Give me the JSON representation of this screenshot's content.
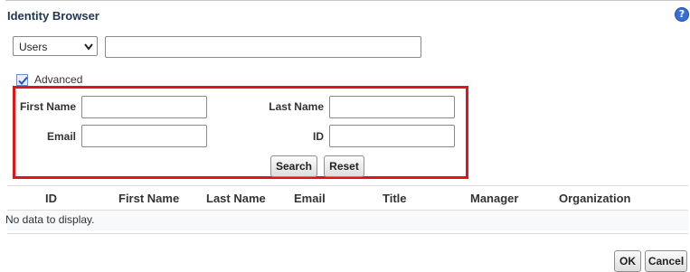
{
  "dialog": {
    "title": "Identity Browser",
    "help_icon": "question-icon"
  },
  "search": {
    "type_selected": "Users",
    "query_value": ""
  },
  "advanced": {
    "label": "Advanced",
    "checked": true
  },
  "fields": {
    "first_name_label": "First Name",
    "last_name_label": "Last Name",
    "email_label": "Email",
    "id_label": "ID"
  },
  "buttons": {
    "search": "Search",
    "reset": "Reset",
    "ok": "OK",
    "cancel": "Cancel"
  },
  "table": {
    "columns": [
      "ID",
      "First Name",
      "Last Name",
      "Email",
      "Title",
      "Manager",
      "Organization"
    ],
    "empty_message": "No data to display."
  },
  "colors": {
    "highlight_border": "#e0141b",
    "title": "#22384f",
    "help_icon": "#3a6fd0"
  }
}
